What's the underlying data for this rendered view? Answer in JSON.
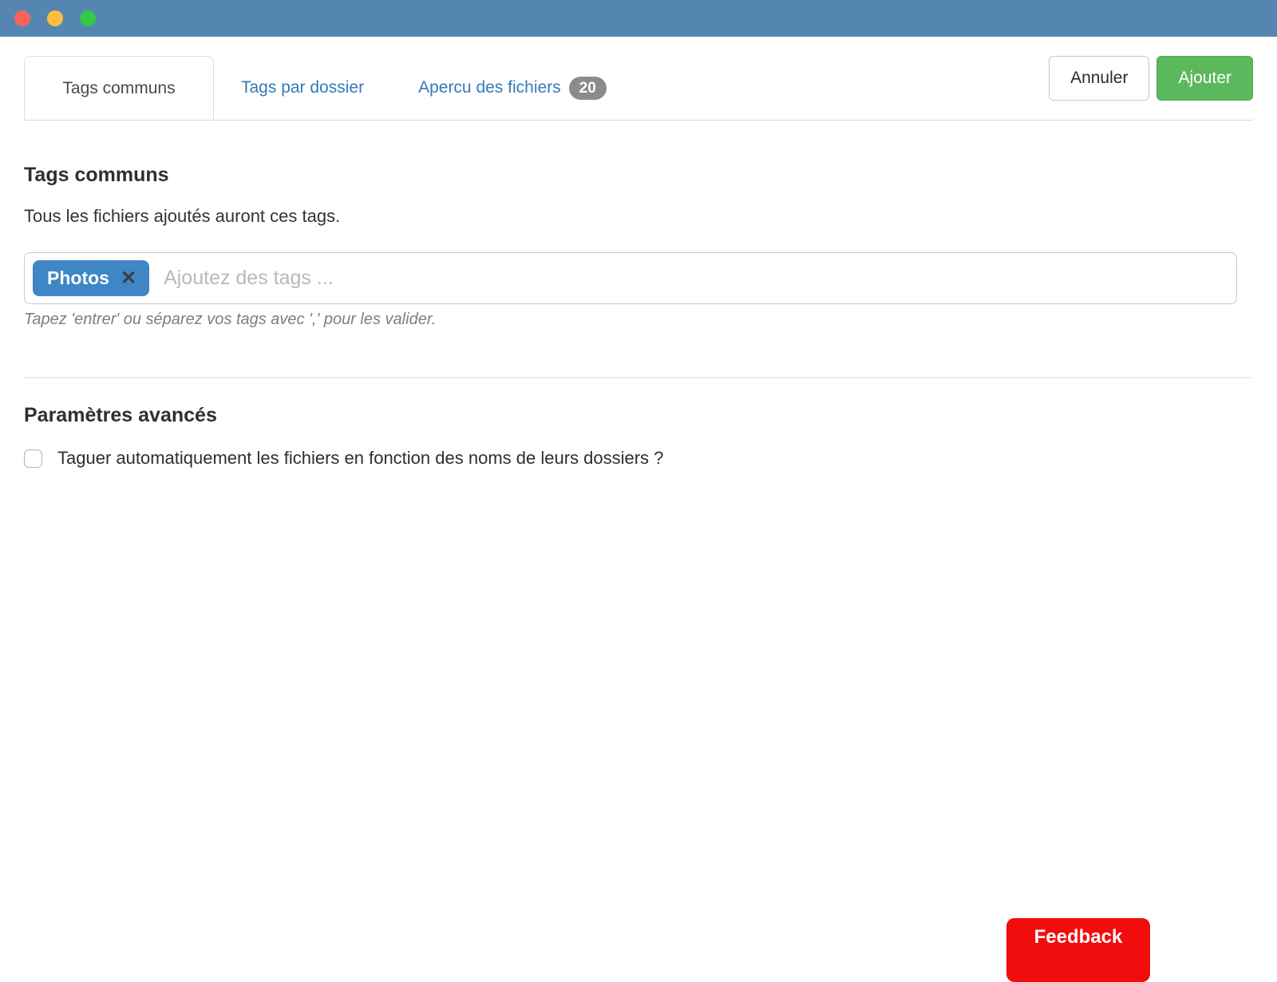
{
  "window": {
    "traffic_lights": [
      "close",
      "minimize",
      "zoom"
    ]
  },
  "tabs": {
    "items": [
      {
        "label": "Tags communs",
        "active": true
      },
      {
        "label": "Tags par dossier",
        "active": false
      },
      {
        "label": "Apercu des fichiers",
        "active": false,
        "badge": "20"
      }
    ]
  },
  "actions": {
    "cancel_label": "Annuler",
    "submit_label": "Ajouter"
  },
  "section_common": {
    "title": "Tags communs",
    "subtitle": "Tous les fichiers ajoutés auront ces tags.",
    "tag_input": {
      "tags": [
        {
          "label": "Photos"
        }
      ],
      "remove_icon": "✕",
      "placeholder": "Ajoutez des tags ...",
      "helper": "Tapez 'entrer' ou séparez vos tags avec ',' pour les valider."
    }
  },
  "section_advanced": {
    "title": "Paramètres avancés",
    "checkbox_label": "Taguer automatiquement les fichiers en fonction des noms de leurs dossiers ?",
    "checked": false
  },
  "feedback": {
    "label": "Feedback"
  },
  "colors": {
    "titlebar": "#5586b2",
    "link_blue": "#337ab7",
    "tag_blue": "#3e86c6",
    "success_green": "#5cb85c",
    "badge_gray": "#8c8c8c",
    "feedback_red": "#f10d0d"
  }
}
